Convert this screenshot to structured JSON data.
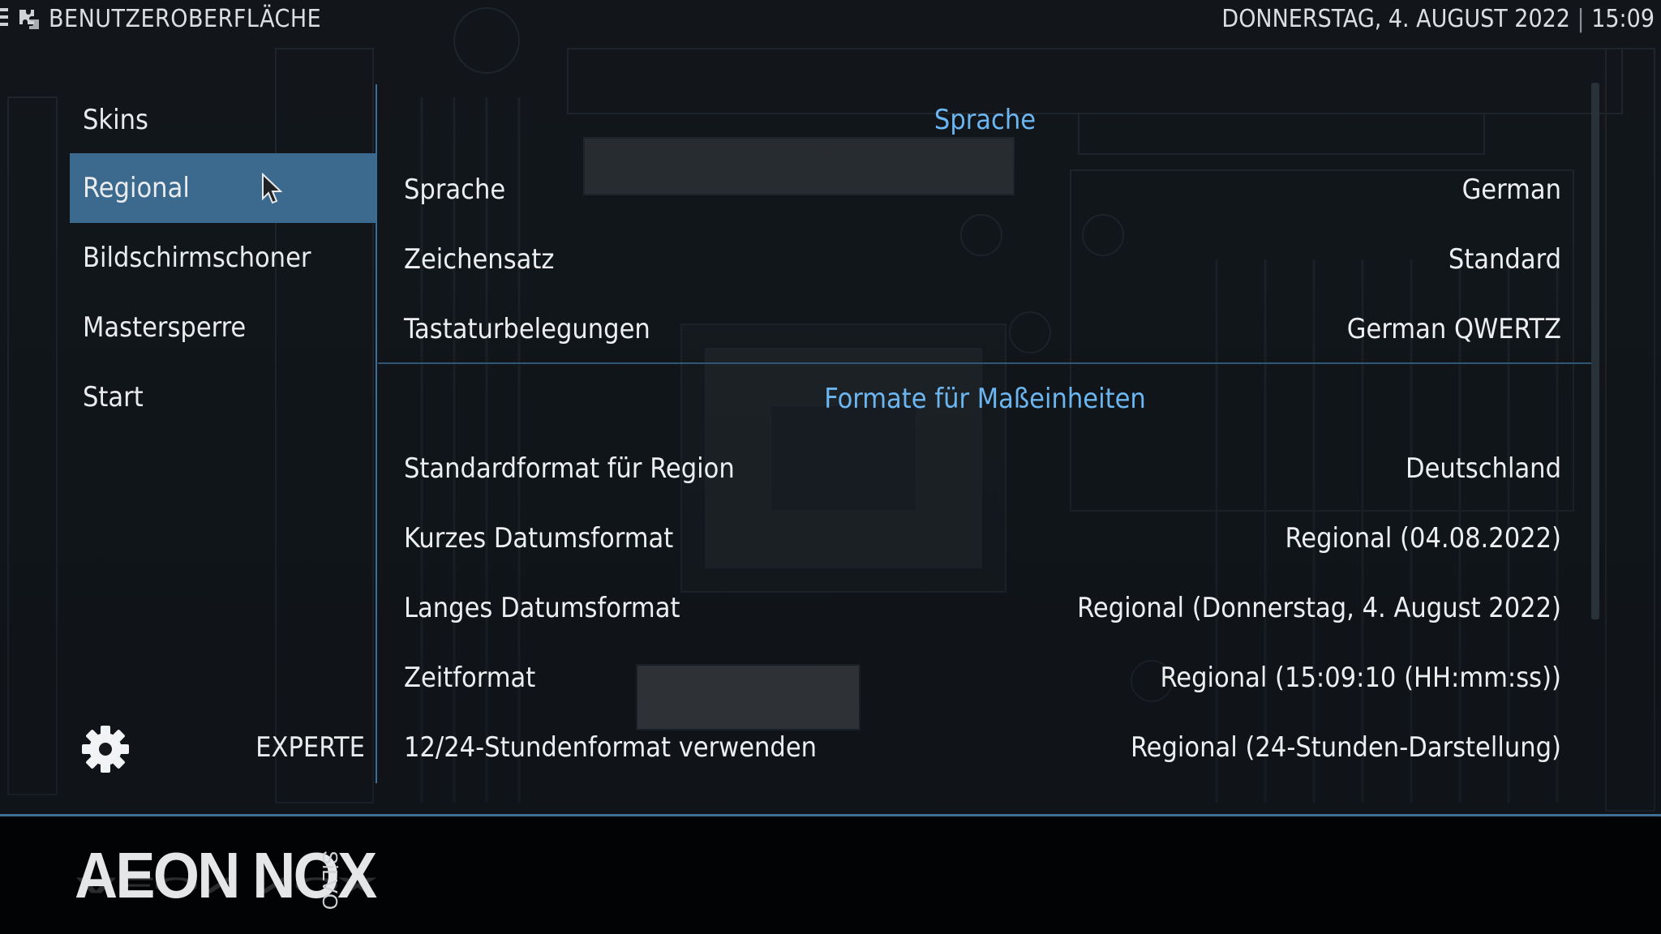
{
  "header": {
    "section_title": "BENUTZEROBERFLÄCHE",
    "date": "DONNERSTAG, 4. AUGUST 2022",
    "separator": "|",
    "time": "15:09"
  },
  "sidebar": {
    "items": [
      {
        "label": "Skins"
      },
      {
        "label": "Regional",
        "active": true
      },
      {
        "label": "Bildschirmschoner"
      },
      {
        "label": "Mastersperre"
      },
      {
        "label": "Start"
      }
    ],
    "expert_label": "EXPERTE",
    "settings_icon": "gear-icon"
  },
  "main": {
    "group1_heading": "Sprache",
    "group1_rows": [
      {
        "label": "Sprache",
        "value": "German"
      },
      {
        "label": "Zeichensatz",
        "value": "Standard"
      },
      {
        "label": "Tastaturbelegungen",
        "value": "German QWERTZ"
      }
    ],
    "group2_heading": "Formate für Maßeinheiten",
    "group2_rows": [
      {
        "label": "Standardformat für Region",
        "value": "Deutschland"
      },
      {
        "label": "Kurzes Datumsformat",
        "value": "Regional (04.08.2022)"
      },
      {
        "label": "Langes Datumsformat",
        "value": "Regional (Donnerstag, 4. August 2022)"
      },
      {
        "label": "Zeitformat",
        "value": "Regional (15:09:10 (HH:mm:ss))"
      },
      {
        "label": "12/24-Stundenformat verwenden",
        "value": "Regional (24-Stunden-Darstellung)"
      }
    ]
  },
  "footer": {
    "logo_main": "AEON NOX",
    "logo_sub": "SiLVO"
  },
  "colors": {
    "accent": "#3c6a8e",
    "heading": "#6bb6f0",
    "divider": "#3b6f97"
  }
}
